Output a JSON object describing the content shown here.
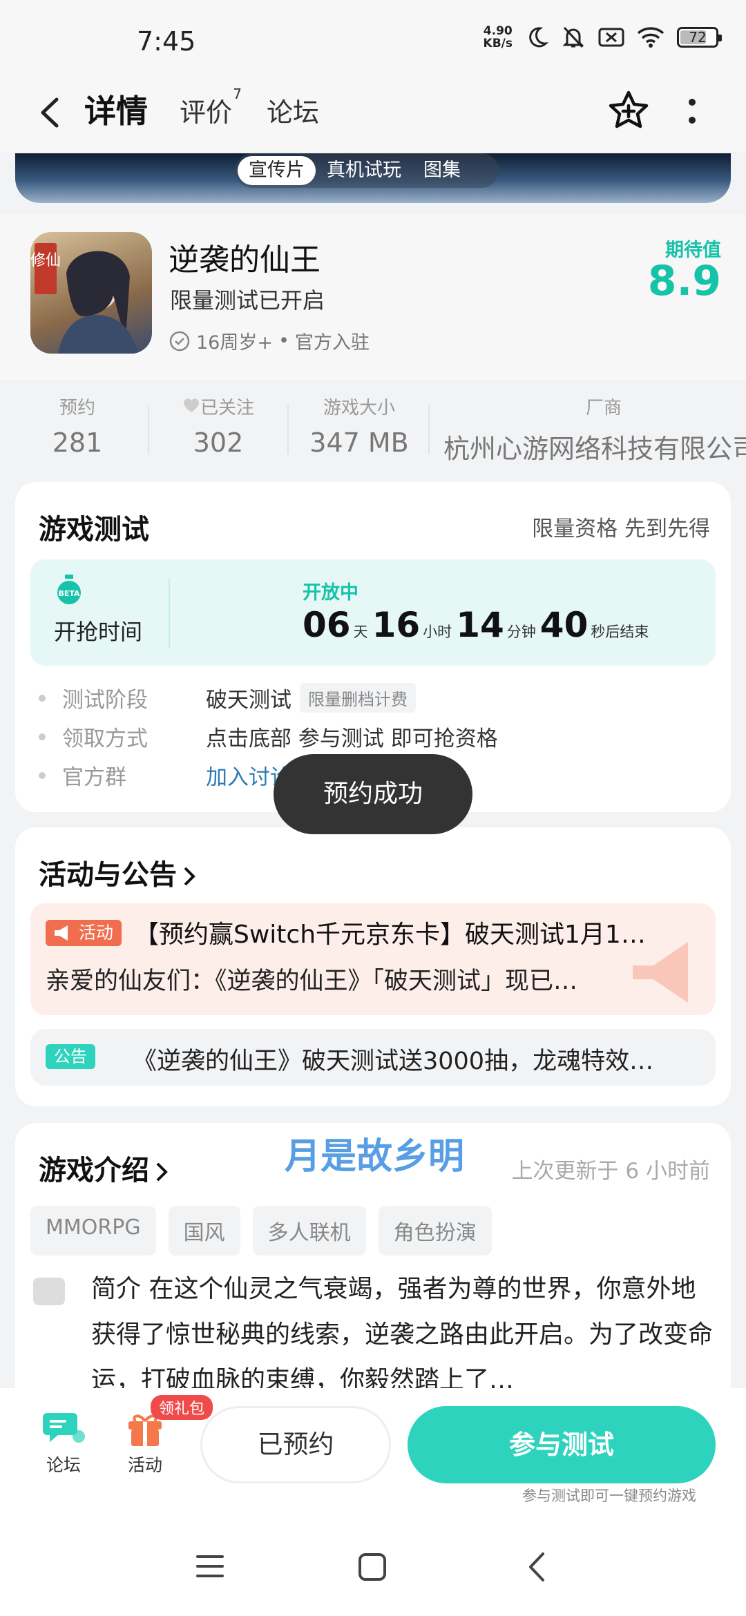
{
  "status": {
    "time": "7:45",
    "net_speed_value": "4.90",
    "net_speed_unit": "KB/s",
    "battery": "72"
  },
  "nav": {
    "tabs": [
      {
        "label": "详情"
      },
      {
        "label": "评价",
        "count": "7"
      },
      {
        "label": "论坛"
      }
    ]
  },
  "media": {
    "tabs": [
      "宣传片",
      "真机试玩",
      "图集"
    ]
  },
  "game": {
    "name": "逆袭的仙王",
    "subtitle": "限量测试已开启",
    "age": "16周岁+",
    "official": "官方入驻",
    "icon_text": "修仙",
    "expect_label": "期待值",
    "expect_value": "8.9"
  },
  "stats": [
    {
      "label": "预约",
      "value": "281"
    },
    {
      "label": "已关注",
      "value": "302"
    },
    {
      "label": "游戏大小",
      "value": "347 MB"
    },
    {
      "label": "厂商",
      "value": "杭州心游网络科技有限公司"
    }
  ],
  "test": {
    "title": "游戏测试",
    "right": "限量资格 先到先得",
    "beta_badge": "BETA",
    "grab_label": "开抢时间",
    "open_label": "开放中",
    "countdown": {
      "days": "06",
      "days_unit": "天",
      "hours": "16",
      "hours_unit": "小时",
      "minutes": "14",
      "minutes_unit": "分钟",
      "seconds": "40",
      "seconds_unit": "秒后结束"
    },
    "rows": [
      {
        "key": "测试阶段",
        "value": "破天测试",
        "tag": "限量删档计费"
      },
      {
        "key": "领取方式",
        "value": "点击底部 参与测试 即可抢资格"
      },
      {
        "key": "官方群",
        "value": "加入讨论"
      }
    ]
  },
  "toast": "预约成功",
  "news": {
    "title": "活动与公告",
    "activity": {
      "badge": "活动",
      "title": "【预约赢Switch千元京东卡】破天测试1月1…",
      "desc": "亲爱的仙友们：《逆袭的仙王》「破天测试」现已…"
    },
    "notice": {
      "badge": "公告",
      "title": "《逆袭的仙王》破天测试送3000抽，龙魂特效…"
    }
  },
  "intro": {
    "title": "游戏介绍",
    "watermark": "月是故乡明",
    "updated": "上次更新于 6 小时前",
    "tags": [
      "MMORPG",
      "国风",
      "多人联机",
      "角色扮演"
    ],
    "text": "简介 在这个仙灵之气衰竭，强者为尊的世界，你意外地获得了惊世秘典的线索，逆袭之路由此开启。为了改变命运，打破血脉的束缚，你毅然踏上了…"
  },
  "bottom": {
    "forum": "论坛",
    "activity": "活动",
    "gift_badge": "领礼包",
    "reserved": "已预约",
    "join": "参与测试",
    "join_hint": "参与测试即可一键预约游戏"
  },
  "colors": {
    "accent": "#2ed3bd",
    "activity": "#f06d4e",
    "link": "#2a7ab5"
  }
}
